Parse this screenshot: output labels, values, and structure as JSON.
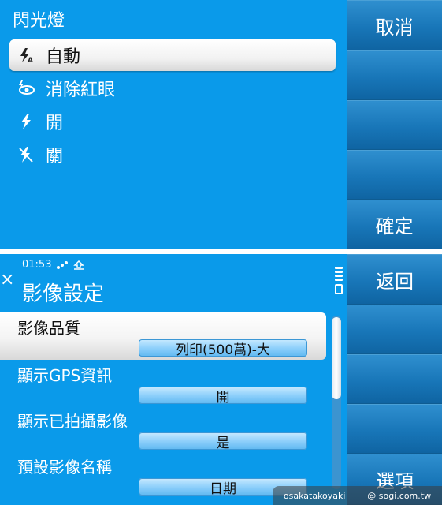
{
  "top_menu": {
    "title": "閃光燈",
    "items": [
      {
        "label": "自動",
        "icon": "flash-auto-icon",
        "selected": true
      },
      {
        "label": "消除紅眼",
        "icon": "red-eye-icon",
        "selected": false
      },
      {
        "label": "開",
        "icon": "flash-on-icon",
        "selected": false
      },
      {
        "label": "關",
        "icon": "flash-off-icon",
        "selected": false
      }
    ],
    "softkeys": {
      "cancel": "取消",
      "confirm": "確定"
    }
  },
  "settings": {
    "status": {
      "time": "01:53"
    },
    "close_glyph": "×",
    "title": "影像設定",
    "items": [
      {
        "label": "影像品質",
        "value": "列印(500萬)-大",
        "selected": true
      },
      {
        "label": "顯示GPS資訊",
        "value": "開",
        "selected": false
      },
      {
        "label": "顯示已拍攝影像",
        "value": "是",
        "selected": false
      },
      {
        "label": "預設影像名稱",
        "value": "日期",
        "selected": false
      }
    ],
    "softkeys": {
      "back": "返回",
      "options": "選項"
    }
  },
  "watermark": {
    "user": "osakatakoyaki",
    "site": "@ sogi.com.tw"
  },
  "colors": {
    "background": "#0a9aea",
    "softkey": "#1f7fc0",
    "value_pill": "#8fd0fb"
  }
}
